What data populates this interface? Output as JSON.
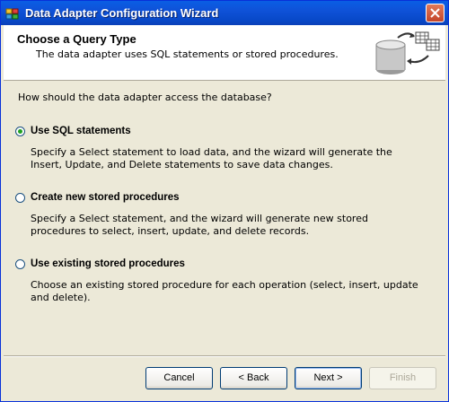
{
  "window": {
    "title": "Data Adapter Configuration Wizard"
  },
  "header": {
    "title": "Choose a Query Type",
    "subtitle": "The data adapter uses SQL statements or stored procedures."
  },
  "question": "How should the data adapter access the database?",
  "options": [
    {
      "label": "Use SQL statements",
      "selected": true,
      "description": "Specify a Select statement to load data, and the wizard will generate the Insert, Update, and Delete statements to save data changes."
    },
    {
      "label": "Create new stored procedures",
      "selected": false,
      "description": "Specify a Select statement, and the wizard will generate new stored procedures to select, insert, update, and delete records."
    },
    {
      "label": "Use existing stored procedures",
      "selected": false,
      "description": "Choose an existing stored procedure for each operation (select, insert, update and delete)."
    }
  ],
  "buttons": {
    "cancel": "Cancel",
    "back": "< Back",
    "next": "Next >",
    "finish": "Finish"
  }
}
